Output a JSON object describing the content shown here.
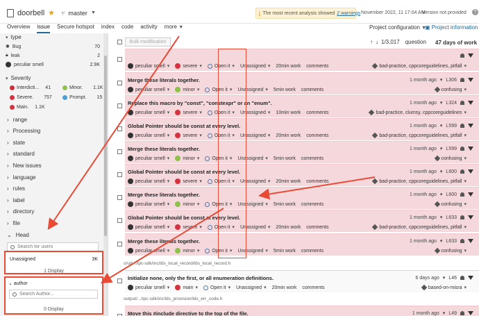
{
  "header": {
    "project": "doorbell",
    "branch": "master",
    "warning_text": "The most recent analysis showed",
    "warning_link": "2 warnings",
    "date": "November 2022, 11 17:04 AM",
    "version": "Version not provided"
  },
  "tabs": [
    {
      "label": "Overview"
    },
    {
      "label": "issue"
    },
    {
      "label": "Secure hotspot"
    },
    {
      "label": "index"
    },
    {
      "label": "code"
    },
    {
      "label": "activity"
    },
    {
      "label": "more"
    }
  ],
  "project_config": "Project configuration",
  "project_info": "Project information",
  "sidebar": {
    "type_label": "type",
    "types": [
      {
        "label": "Bug",
        "count": "70"
      },
      {
        "label": "leak",
        "count": "2"
      },
      {
        "label": "peculiar smell",
        "count": "2.9K"
      }
    ],
    "severity_label": "Severity",
    "severities": [
      {
        "label": "Interdicti...",
        "count": "41",
        "color": "#d02f3a"
      },
      {
        "label": "Minor.",
        "count": "1.1K",
        "color": "#8ec14c"
      },
      {
        "label": "Severe.",
        "count": "757",
        "color": "#d4333f"
      },
      {
        "label": "Prompt.",
        "count": "15",
        "color": "#4b9fd5"
      },
      {
        "label": "Main.",
        "count": "1.1K",
        "color": "#d4333f"
      }
    ],
    "facets": [
      "range",
      "Processing",
      "state",
      "standard",
      "New issues",
      "language",
      "rules",
      "label",
      "directory",
      "file",
      "Head"
    ],
    "search_users_placeholder": "Search for users",
    "unassigned_label": "Unassigned",
    "unassigned_count": "3K",
    "unassigned_display": "1 Display",
    "author_label": "author",
    "author_placeholder": "Search Author...",
    "author_display": "0 Display"
  },
  "toolbar": {
    "bulk_label": "Bulk modification",
    "count": "1/3,017",
    "count_unit": "question",
    "days": "47 days of work"
  },
  "issues": [
    {
      "msg": "",
      "severity": "severe",
      "sev_color": "#d4333f",
      "effort": "20min work",
      "time": "",
      "line": "",
      "tags": "bad-practice, cppcoreguidelines, pitfall",
      "style": "plain"
    },
    {
      "msg": "Merge these literals together.",
      "severity": "minor",
      "sev_color": "#8ec14c",
      "effort": "5min work",
      "time": "1 month ago",
      "line": "L306",
      "tags": "confusing",
      "style": "plain"
    },
    {
      "msg": "Replace this macro by \"const\", \"constexpr\" or an \"enum\".",
      "severity": "severe",
      "sev_color": "#d4333f",
      "effort": "10min work",
      "time": "1 month ago",
      "line": "L324",
      "tags": "bad-practice, clumsy, cppcoreguidelines",
      "style": "plain"
    },
    {
      "msg": "Global Pointer should be const at every level.",
      "severity": "severe",
      "sev_color": "#d4333f",
      "effort": "20min work",
      "time": "1 month ago",
      "line": "L599",
      "tags": "bad-practice, cppcoreguidelines, pitfall",
      "style": "plain"
    },
    {
      "msg": "Merge these literals together.",
      "severity": "minor",
      "sev_color": "#8ec14c",
      "effort": "5min work",
      "time": "1 month ago",
      "line": "L599",
      "tags": "confusing",
      "style": "plain"
    },
    {
      "msg": "Global Pointer should be const at every level.",
      "severity": "severe",
      "sev_color": "#d4333f",
      "effort": "20min work",
      "time": "1 month ago",
      "line": "L600",
      "tags": "bad-practice, cppcoreguidelines, pitfall",
      "style": "plain"
    },
    {
      "msg": "Merge these literals together.",
      "severity": "minor",
      "sev_color": "#8ec14c",
      "effort": "5min work",
      "time": "1 month ago",
      "line": "L600",
      "tags": "confusing",
      "style": "plain"
    },
    {
      "msg": "Global Pointer should be const at every level.",
      "severity": "severe",
      "sev_color": "#d4333f",
      "effort": "20min work",
      "time": "1 month ago",
      "line": "L633",
      "tags": "bad-practice, cppcoreguidelines, pitfall",
      "style": "plain"
    },
    {
      "msg": "Merge these literals together.",
      "severity": "minor",
      "sev_color": "#8ec14c",
      "effort": "5min work",
      "time": "1 month ago",
      "line": "L633",
      "tags": "confusing",
      "style": "plain"
    },
    {
      "msg": "Initialize none, only the first, or all enumeration definitions.",
      "severity": "main",
      "sev_color": "#d4333f",
      "effort": "20min work",
      "time": "6 days ago",
      "line": "L46",
      "tags": "based-on-misra",
      "style": "white"
    },
    {
      "msg": "Move this #include directive to the top of the file.",
      "severity": "",
      "sev_color": "#d4333f",
      "effort": "",
      "time": "1 month ago",
      "line": "L49",
      "tags": "",
      "style": "plain"
    }
  ],
  "issue_common": {
    "type": "peculiar smell",
    "status": "Open it",
    "assignee": "Unassigned",
    "comments": "comments"
  },
  "paths": [
    "o/ud.../ipc-sdk/inc/lds_local_record/lds_local_record.h",
    "output/.../ipc-sdk/inc/lds_provision/lds_err_code.h"
  ]
}
